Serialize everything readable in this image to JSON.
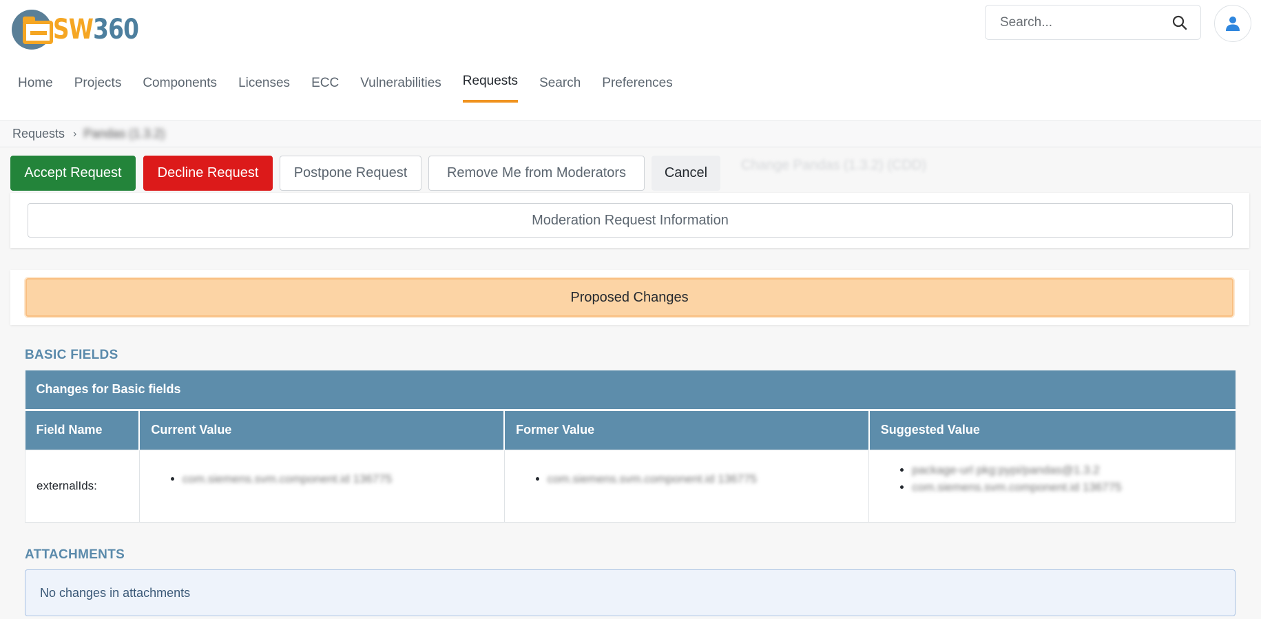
{
  "app": {
    "logo_text_sw": "SW",
    "logo_text_num": "360"
  },
  "search": {
    "placeholder": "Search..."
  },
  "nav": {
    "items": [
      "Home",
      "Projects",
      "Components",
      "Licenses",
      "ECC",
      "Vulnerabilities",
      "Requests",
      "Search",
      "Preferences"
    ],
    "active": "Requests"
  },
  "breadcrumb": {
    "root": "Requests",
    "current": "Pandas (1.3.2)"
  },
  "actions": {
    "accept": "Accept Request",
    "decline": "Decline Request",
    "postpone": "Postpone Request",
    "remove_moderator": "Remove Me from Moderators",
    "cancel": "Cancel"
  },
  "request_title": "Change Pandas (1.3.2) (CDD)",
  "moderation_info_label": "Moderation Request Information",
  "proposed_changes_label": "Proposed Changes",
  "basic_fields": {
    "heading": "BASIC FIELDS",
    "caption": "Changes for Basic fields",
    "columns": [
      "Field Name",
      "Current Value",
      "Former Value",
      "Suggested Value"
    ],
    "rows": [
      {
        "field": "externalIds:",
        "current": [
          "com.siemens.svm.component.id 136775"
        ],
        "former": [
          "com.siemens.svm.component.id 136775"
        ],
        "suggested": [
          "package-url pkg:pypi/pandas@1.3.2",
          "com.siemens.svm.component.id 136775"
        ]
      }
    ]
  },
  "attachments": {
    "heading": "ATTACHMENTS",
    "message": "No changes in attachments"
  },
  "colors": {
    "accept": "#23843a",
    "decline": "#dc1a1a",
    "nav_active_underline": "#f0931f",
    "table_header": "#5d8dab",
    "proposed_bg": "#fcd4a5",
    "section_heading": "#5a8aab"
  }
}
